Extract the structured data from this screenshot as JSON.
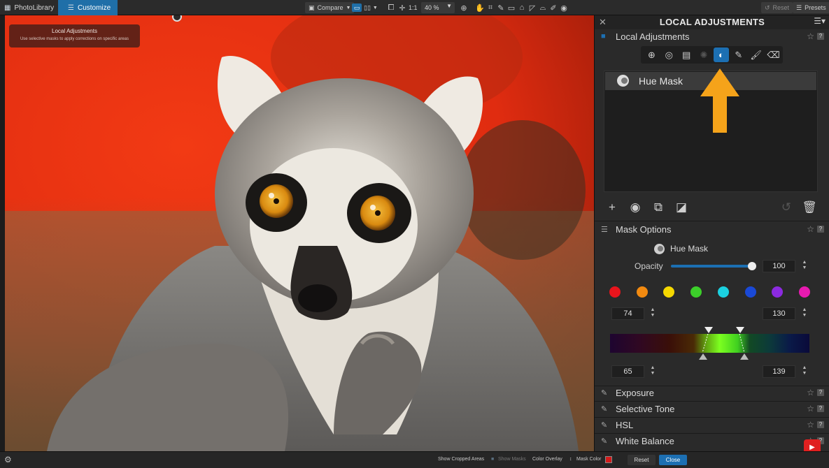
{
  "topbar": {
    "tabs": [
      {
        "label": "PhotoLibrary",
        "icon": "grid-icon"
      },
      {
        "label": "Customize",
        "icon": "sliders-icon"
      }
    ],
    "compare_label": "Compare",
    "zoom_fit": "1:1",
    "zoom_value": "40 %",
    "reset_label": "Reset",
    "presets_label": "Presets"
  },
  "tooltip": {
    "title": "Local Adjustments",
    "subtitle": "Use selective masks to apply corrections on specific areas"
  },
  "panel": {
    "title": "LOCAL ADJUSTMENTS",
    "section_local": "Local Adjustments",
    "tools": [
      "control-point-icon",
      "auto-mask-icon",
      "graduated-filter-icon",
      "eraser-point-icon",
      "hue-mask-icon",
      "brush-a-icon",
      "brush-icon",
      "eraser-icon"
    ],
    "active_tool_index": 4,
    "mask_item": "Hue Mask",
    "mask_options": {
      "section_label": "Mask Options",
      "mask_name": "Hue Mask",
      "opacity_label": "Opacity",
      "opacity_value": "100",
      "opacity_fraction": 0.98,
      "hue_range_top_left": "74",
      "hue_range_top_right": "130",
      "hue_range_bottom_left": "65",
      "hue_range_bottom_right": "139",
      "swatches": [
        "#e8141c",
        "#f28a10",
        "#f5d800",
        "#3ccf2a",
        "#1bd1e0",
        "#1a49d6",
        "#8c2ae0",
        "#e81ab0"
      ]
    },
    "sections": [
      "Exposure",
      "Selective Tone",
      "HSL",
      "White Balance"
    ]
  },
  "bottombar": {
    "show_cropped_areas": "Show Cropped Areas",
    "show_masks": "Show Masks",
    "color_overlay": "Color Overlay",
    "mask_color_label": "Mask Color",
    "mask_color": "#d41a1a",
    "reset_label": "Reset",
    "close_label": "Close"
  },
  "colors": {
    "accent": "#1c6fb2",
    "arrow": "#f5a31a"
  }
}
